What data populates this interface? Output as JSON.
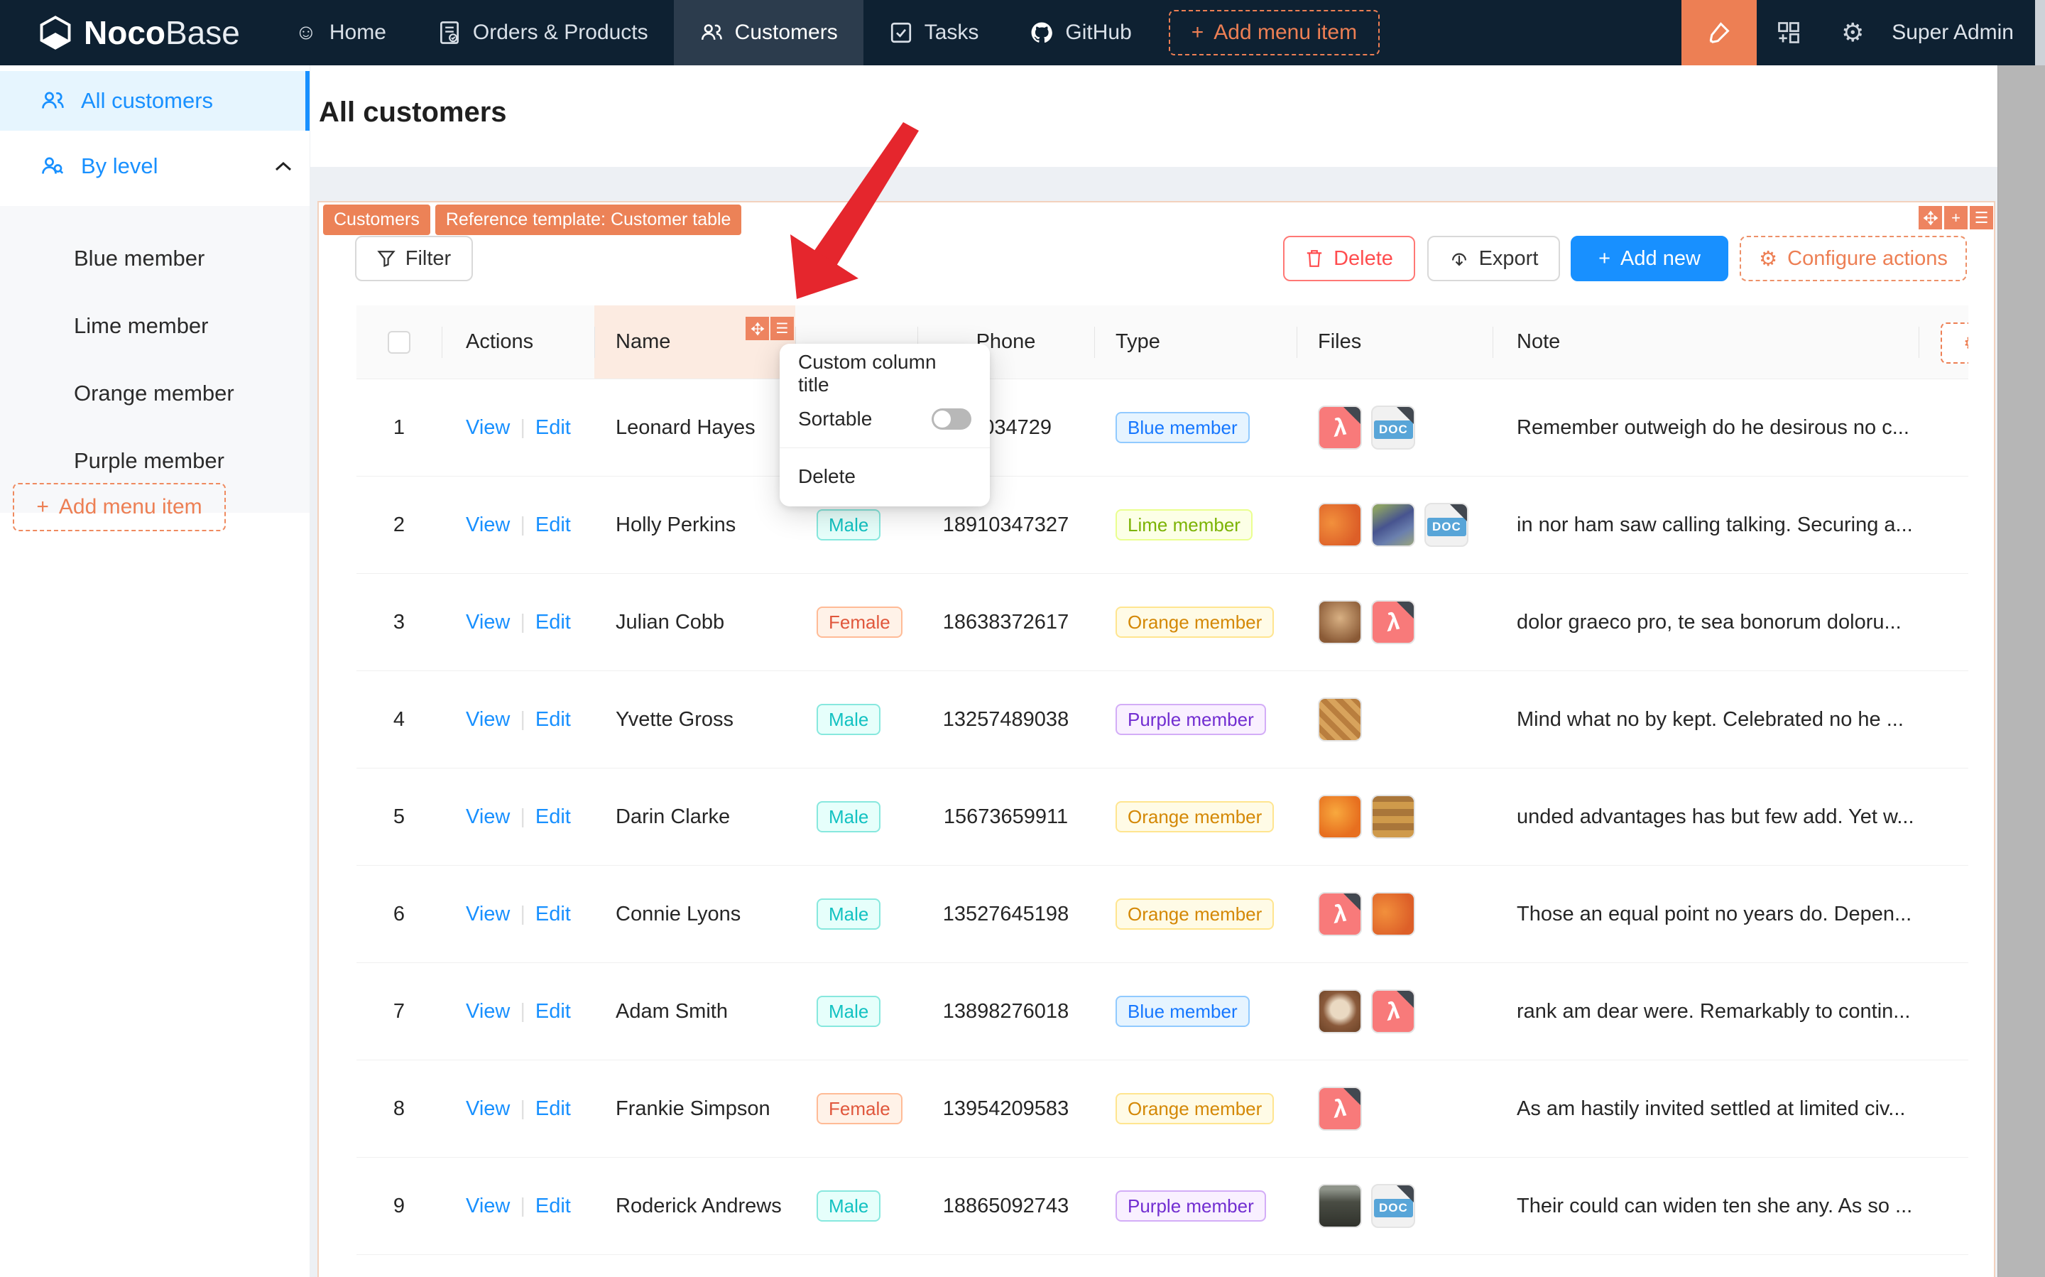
{
  "navbar": {
    "logo_prefix": "Noco",
    "logo_suffix": "Base",
    "items": [
      {
        "label": "Home",
        "icon": "smiley-icon",
        "active": false
      },
      {
        "label": "Orders & Products",
        "icon": "invoice-icon",
        "active": false
      },
      {
        "label": "Customers",
        "icon": "team-icon",
        "active": true
      },
      {
        "label": "Tasks",
        "icon": "check-square-icon",
        "active": false
      },
      {
        "label": "GitHub",
        "icon": "github-icon",
        "active": false
      }
    ],
    "add_menu_item_label": "Add menu item",
    "user_label": "Super Admin"
  },
  "sidebar": {
    "items": [
      {
        "label": "All customers",
        "active": true
      },
      {
        "label": "By level",
        "active": false,
        "expanded": true
      }
    ],
    "by_level_children": [
      "Blue member",
      "Lime member",
      "Orange member",
      "Purple member"
    ],
    "add_menu_item_label": "Add menu item"
  },
  "page": {
    "title": "All customers"
  },
  "block": {
    "tags": [
      "Customers",
      "Reference template: Customer table"
    ],
    "toolbar": {
      "filter": "Filter",
      "delete": "Delete",
      "export": "Export",
      "add_new": "Add new",
      "configure_actions": "Configure actions"
    }
  },
  "table": {
    "headers": {
      "actions": "Actions",
      "name": "Name",
      "gender": "",
      "phone": "Phone",
      "type": "Type",
      "files": "Files",
      "note": "Note"
    },
    "action_labels": [
      "View",
      "Edit"
    ],
    "rows": [
      {
        "index": "1",
        "name": "Leonard Hayes",
        "gender": "",
        "gender_palette": "",
        "phone": "98034729",
        "type": "Blue member",
        "type_palette": "p-blue",
        "files": [
          "pdf",
          "doc"
        ],
        "note": "Remember outweigh do he desirous no c..."
      },
      {
        "index": "2",
        "name": "Holly Perkins",
        "gender": "Male",
        "gender_palette": "p-cyan",
        "phone": "18910347327",
        "type": "Lime member",
        "type_palette": "p-lime",
        "files": [
          "img-pomegranate",
          "img-grapes",
          "doc"
        ],
        "note": "in nor ham saw calling talking. Securing a..."
      },
      {
        "index": "3",
        "name": "Julian Cobb",
        "gender": "Female",
        "gender_palette": "p-volcano",
        "phone": "18638372617",
        "type": "Orange member",
        "type_palette": "p-gold",
        "files": [
          "img-food",
          "pdf"
        ],
        "note": "dolor graeco pro, te sea bonorum doloru..."
      },
      {
        "index": "4",
        "name": "Yvette Gross",
        "gender": "Male",
        "gender_palette": "p-cyan",
        "phone": "13257489038",
        "type": "Purple member",
        "type_palette": "p-purple",
        "files": [
          "img-pastry"
        ],
        "note": "Mind what no by kept. Celebrated no he ..."
      },
      {
        "index": "5",
        "name": "Darin Clarke",
        "gender": "Male",
        "gender_palette": "p-cyan",
        "phone": "15673659911",
        "type": "Orange member",
        "type_palette": "p-gold",
        "files": [
          "img-oranges",
          "img-pastry2"
        ],
        "note": "unded advantages has but few add. Yet w..."
      },
      {
        "index": "6",
        "name": "Connie Lyons",
        "gender": "Male",
        "gender_palette": "p-cyan",
        "phone": "13527645198",
        "type": "Orange member",
        "type_palette": "p-gold",
        "files": [
          "pdf",
          "img-pomegranate"
        ],
        "note": "Those an equal point no years do. Depen..."
      },
      {
        "index": "7",
        "name": "Adam Smith",
        "gender": "Male",
        "gender_palette": "p-cyan",
        "phone": "13898276018",
        "type": "Blue member",
        "type_palette": "p-blue",
        "files": [
          "img-coffee",
          "pdf"
        ],
        "note": "rank am dear were. Remarkably to contin..."
      },
      {
        "index": "8",
        "name": "Frankie Simpson",
        "gender": "Female",
        "gender_palette": "p-volcano",
        "phone": "13954209583",
        "type": "Orange member",
        "type_palette": "p-gold",
        "files": [
          "pdf"
        ],
        "note": "As am hastily invited settled at limited civ..."
      },
      {
        "index": "9",
        "name": "Roderick Andrews",
        "gender": "Male",
        "gender_palette": "p-cyan",
        "phone": "18865092743",
        "type": "Purple member",
        "type_palette": "p-purple",
        "files": [
          "img-building",
          "doc"
        ],
        "note": "Their could can widen ten she any. As so ..."
      }
    ]
  },
  "column_menu": {
    "items": [
      {
        "label": "Custom column title"
      },
      {
        "label": "Sortable",
        "toggle_state": "off"
      },
      {
        "label": "Delete"
      }
    ]
  },
  "colors": {
    "accent_orange": "#ed7f54",
    "primary_blue": "#1890ff",
    "danger_red": "#ff4d4f",
    "navbar_bg": "#0e2132",
    "arrow_red": "#e5262d"
  }
}
